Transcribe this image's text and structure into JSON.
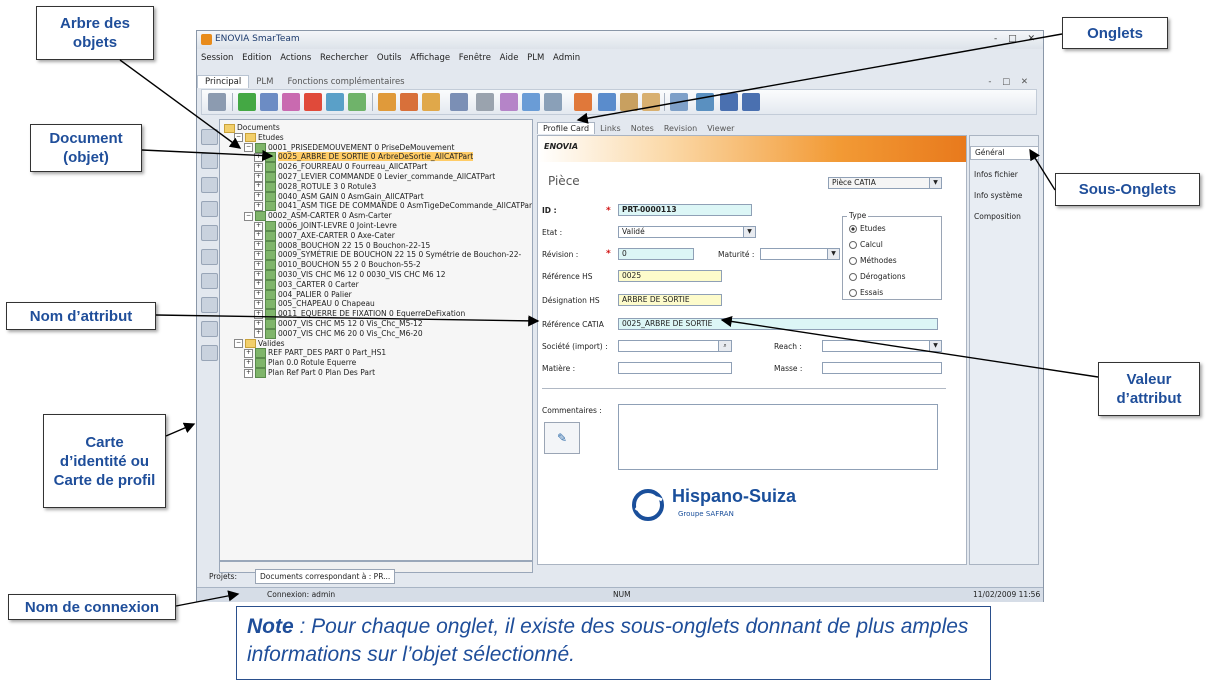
{
  "callouts": {
    "arbre": "Arbre des objets",
    "onglets": "Onglets",
    "document": "Document (objet)",
    "sous_onglets": "Sous-Onglets",
    "nom_attribut": "Nom d’attribut",
    "valeur_attribut": "Valeur d’attribut",
    "carte": "Carte d’identité ou Carte de profil",
    "connexion": "Nom de connexion"
  },
  "note": {
    "bold": "Note",
    "text": " : Pour chaque onglet, il existe des sous-onglets donnant de plus amples informations sur l’objet sélectionné."
  },
  "window": {
    "title": "ENOVIA SmarTeam",
    "controls": "- □ ✕",
    "menu": [
      "Session",
      "Edition",
      "Actions",
      "Rechercher",
      "Outils",
      "Affichage",
      "Fenêtre",
      "Aide",
      "PLM",
      "Admin"
    ],
    "ribbon_tabs": [
      "Principal",
      "PLM",
      "Fonctions complémentaires"
    ]
  },
  "tree": [
    {
      "label": "Documents",
      "indent": 0,
      "type": "root"
    },
    {
      "label": "Etudes",
      "indent": 1,
      "type": "folder"
    },
    {
      "label": "0001_PRISEDEMOUVEMENT 0 PriseDeMouvement",
      "indent": 2,
      "type": "assy"
    },
    {
      "label": "0025_ARBRE DE SORTIE 0 ArbreDeSortie_AllCATPart",
      "indent": 3,
      "type": "part",
      "selected": true
    },
    {
      "label": "0026_FOURREAU 0 Fourreau_AllCATPart",
      "indent": 3,
      "type": "part"
    },
    {
      "label": "0027_LEVIER COMMANDE 0 Levier_commande_AllCATPart",
      "indent": 3,
      "type": "part"
    },
    {
      "label": "0028_ROTULE 3 0 Rotule3",
      "indent": 3,
      "type": "part"
    },
    {
      "label": "0040_ASM GAIN 0 AsmGain_AllCATPart",
      "indent": 3,
      "type": "part"
    },
    {
      "label": "0041_ASM TIGE DE COMMANDE 0 AsmTigeDeCommande_AllCATPart",
      "indent": 3,
      "type": "part"
    },
    {
      "label": "0002_ASM-CARTER 0 Asm-Carter",
      "indent": 2,
      "type": "assy"
    },
    {
      "label": "0006_JOINT-LEVRE 0 Joint-Levre",
      "indent": 3,
      "type": "part"
    },
    {
      "label": "0007_AXE-CARTER 0 Axe-Cater",
      "indent": 3,
      "type": "part"
    },
    {
      "label": "0008_BOUCHON 22 15 0 Bouchon-22-15",
      "indent": 3,
      "type": "part"
    },
    {
      "label": "0009_SYMÉTRIE DE BOUCHON 22 15 0 Symétrie de Bouchon-22-",
      "indent": 3,
      "type": "part"
    },
    {
      "label": "0010_BOUCHON 55 2 0 Bouchon-55-2",
      "indent": 3,
      "type": "part"
    },
    {
      "label": "0030_VIS CHC M6 12 0 0030_VIS CHC M6 12",
      "indent": 3,
      "type": "part"
    },
    {
      "label": "003_CARTER 0 Carter",
      "indent": 3,
      "type": "part"
    },
    {
      "label": "004_PALIER 0 Palier",
      "indent": 3,
      "type": "part"
    },
    {
      "label": "005_CHAPEAU 0 Chapeau",
      "indent": 3,
      "type": "part"
    },
    {
      "label": "0011_EQUERRE DE FIXATION 0 EquerreDeFixation",
      "indent": 3,
      "type": "part"
    },
    {
      "label": "0007_VIS CHC M5 12 0 Vis_Chc_M5-12",
      "indent": 3,
      "type": "part"
    },
    {
      "label": "0007_VIS CHC M6 20 0 Vis_Chc_M6-20",
      "indent": 3,
      "type": "part"
    },
    {
      "label": "Valides",
      "indent": 1,
      "type": "folder"
    },
    {
      "label": "REF PART_DES PART 0 Part_HS1",
      "indent": 2,
      "type": "part"
    },
    {
      "label": "Plan 0.0 Rotule Equerre",
      "indent": 2,
      "type": "plan"
    },
    {
      "label": "Plan Ref Part 0 Plan Des Part",
      "indent": 2,
      "type": "plan"
    }
  ],
  "detail_tabs": [
    "Profile Card",
    "Links",
    "Notes",
    "Revision",
    "Viewer"
  ],
  "card": {
    "enovia": "ENOVIA",
    "heading": "Pièce",
    "class_select": "Pièce CATIA",
    "fields": {
      "id_label": "ID :",
      "id_value": "PRT-0000113",
      "etat_label": "Etat :",
      "etat_value": "Validé",
      "revision_label": "Révision :",
      "revision_value": "0",
      "maturite_label": "Maturité :",
      "maturite_value": "",
      "refhs_label": "Référence HS",
      "refhs_value": "0025",
      "deshs_label": "Désignation HS",
      "deshs_value": "ARBRE DE SORTIE",
      "refcatia_label": "Référence CATIA",
      "refcatia_value": "0025_ARBRE DE SORTIE",
      "societe_label": "Société (import) :",
      "societe_value": "",
      "reach_label": "Reach :",
      "reach_value": "",
      "matiere_label": "Matière :",
      "matiere_value": "",
      "masse_label": "Masse :",
      "masse_value": "",
      "commentaires_label": "Commentaires :"
    },
    "type_group": {
      "label": "Type",
      "options": [
        "Etudes",
        "Calcul",
        "Méthodes",
        "Dérogations",
        "Essais"
      ],
      "selected": "Etudes"
    },
    "brand": "Hispano-Suiza",
    "brand_sub": "Groupe SAFRAN"
  },
  "subtabs": [
    "Général",
    "Infos fichier",
    "Info système",
    "Composition"
  ],
  "projets": {
    "label": "Projets:",
    "tab": "Documents correspondant à : PR..."
  },
  "status": {
    "connexion": "Connexion: admin",
    "num": "NUM",
    "datetime": "11/02/2009 11:56"
  },
  "colors": {
    "callout_text": "#1f4e9a",
    "banner_orange": "#e8791c",
    "selected_row": "#ffcc66"
  }
}
